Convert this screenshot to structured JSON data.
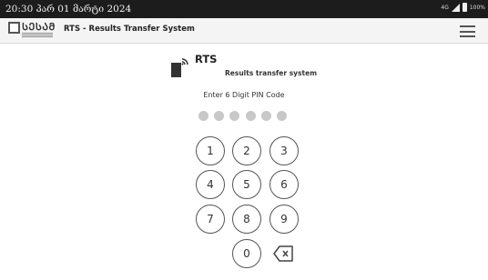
{
  "status_bar": {
    "time": "20:30 პარ 01 მარტი 2024",
    "network": "4G",
    "battery": "100%"
  },
  "app_bar": {
    "logo_text": "ᲡᲔᲡᲐᲛ",
    "title": "RTS - Results Transfer System",
    "menu_icon": "hamburger-menu-icon"
  },
  "header": {
    "icon": "phone-signal-icon",
    "title": "RTS",
    "subtitle": "Results transfer system"
  },
  "pin": {
    "prompt": "Enter 6 Digit PIN Code",
    "digits_entered": 0,
    "length": 6
  },
  "keypad": {
    "keys": [
      "1",
      "2",
      "3",
      "4",
      "5",
      "6",
      "7",
      "8",
      "9",
      "0"
    ],
    "backspace_icon": "backspace-icon"
  }
}
